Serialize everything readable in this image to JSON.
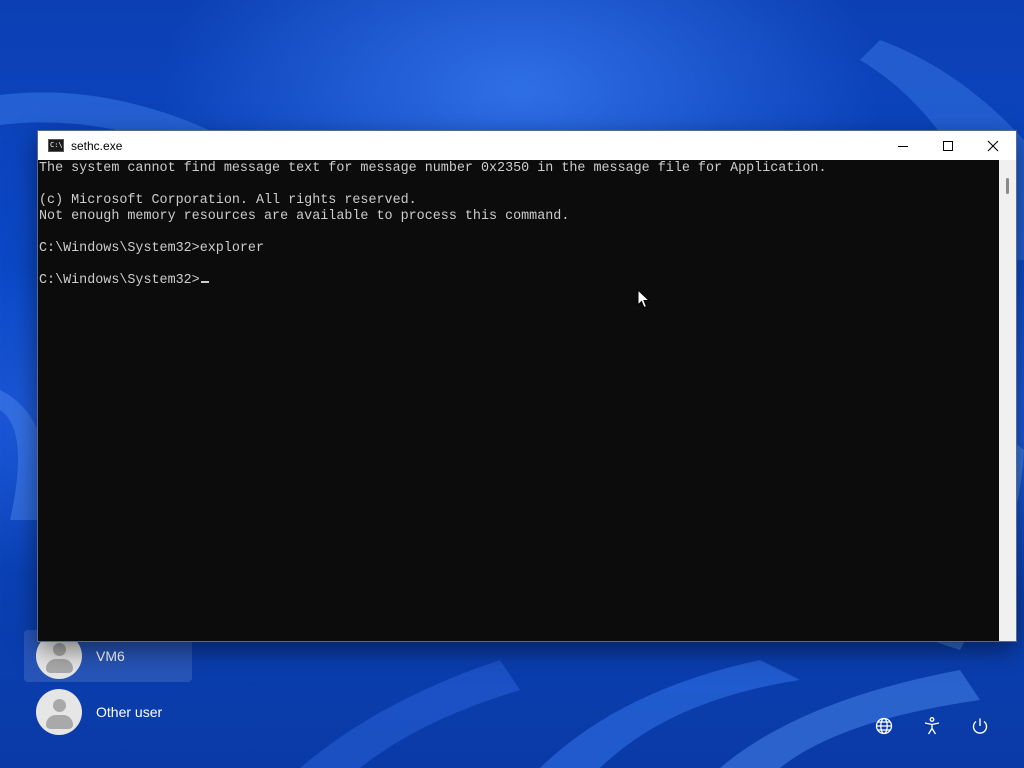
{
  "window": {
    "title": "sethc.exe",
    "icon": "command-prompt-icon",
    "icon_glyph": "C:\\"
  },
  "console": {
    "lines": [
      "The system cannot find message text for message number 0x2350 in the message file for Application.",
      "",
      "(c) Microsoft Corporation. All rights reserved.",
      "Not enough memory resources are available to process this command.",
      "",
      "C:\\Windows\\System32>explorer",
      "",
      "C:\\Windows\\System32>"
    ]
  },
  "users": [
    {
      "name": "VM6",
      "selected": true
    },
    {
      "name": "Other user",
      "selected": false
    }
  ],
  "system_buttons": [
    "network-icon",
    "accessibility-icon",
    "power-icon"
  ],
  "colors": {
    "console_bg": "#0c0c0c",
    "console_text": "#cccccc",
    "wallpaper": "#0a49c8"
  }
}
